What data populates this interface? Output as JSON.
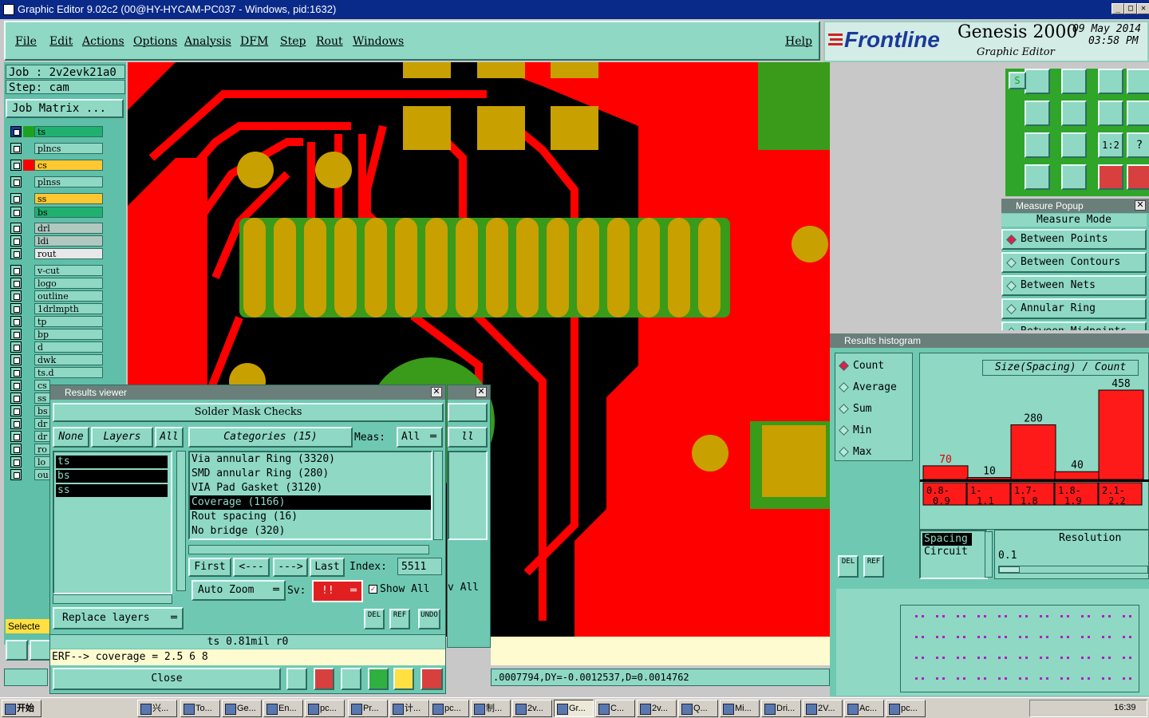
{
  "window": {
    "title": "Graphic Editor 9.02c2 (00@HY-HYCAM-PC037 - Windows, pid:1632)"
  },
  "menu": {
    "items": [
      "File",
      "Edit",
      "Actions",
      "Options",
      "Analysis",
      "DFM",
      "Step",
      "Rout",
      "Windows"
    ],
    "help": "Help"
  },
  "brand": {
    "logo": "Frontline",
    "product": "Genesis 2000",
    "subtitle": "Graphic Editor",
    "date": "09 May 2014",
    "time": "03:58 PM"
  },
  "job": {
    "job_label": "Job  : 2v2evk21a0",
    "step_label": "Step: cam",
    "matrix_button": "Job Matrix ..."
  },
  "layers": [
    {
      "name": "ts",
      "color": "#20a020",
      "active": true
    },
    {
      "name": "plncs",
      "color": ""
    },
    {
      "name": "cs",
      "color": "#ff0000",
      "active": true
    },
    {
      "name": "plnss",
      "color": ""
    },
    {
      "name": "ss",
      "color": "",
      "active": true
    },
    {
      "name": "bs",
      "color": ""
    },
    {
      "name": "drl",
      "color": ""
    },
    {
      "name": "ldi",
      "color": ""
    },
    {
      "name": "rout",
      "color": ""
    },
    {
      "name": "v-cut",
      "color": ""
    },
    {
      "name": "logo",
      "color": ""
    },
    {
      "name": "outline",
      "color": ""
    },
    {
      "name": "1drlmpth",
      "color": ""
    },
    {
      "name": "tp",
      "color": ""
    },
    {
      "name": "bp",
      "color": ""
    },
    {
      "name": "d",
      "color": ""
    },
    {
      "name": "dwk",
      "color": ""
    },
    {
      "name": "ts.d",
      "color": ""
    }
  ],
  "layers_lower": [
    "cs",
    "ss",
    "bs",
    "dr",
    "dr",
    "ro",
    "lo",
    "ou"
  ],
  "left_status": {
    "selected": "Selecte"
  },
  "results_viewer": {
    "title": "Results viewer",
    "header": "Solder Mask Checks",
    "none_btn": "None",
    "layers_btn": "Layers",
    "all_btn": "All",
    "categories_label": "Categories (15)",
    "meas_label": "Meas:",
    "meas_value": "All",
    "behind_all": "ll",
    "layers_list": [
      "ts",
      "bs",
      "ss"
    ],
    "categories": [
      "Via annular Ring (3320)",
      "SMD annular Ring (280)",
      "VIA Pad Gasket (3120)",
      "Coverage (1166)",
      "Rout spacing (16)",
      "No bridge (320)"
    ],
    "selected_category": 3,
    "nav": {
      "first": "First",
      "prev": "<---",
      "next": "--->",
      "last": "Last",
      "index_label": "Index:",
      "index_value": "5511"
    },
    "auto_zoom": "Auto Zoom",
    "sv_label": "Sv:",
    "sv_value": "!!",
    "show_all": "Show All",
    "behind_show_all": "v All",
    "replace_layers": "Replace layers",
    "icon_del": "DEL",
    "icon_ref": "REF",
    "icon_undo": "UNDO",
    "status1": "ts 0.81mil  r0",
    "status2": "ERF--> coverage = 2.5 6 8",
    "close": "Close"
  },
  "coords": {
    "text": ".0007794,DY=-0.0012537,D=0.0014762"
  },
  "measure_popup": {
    "title": "Measure Popup",
    "mode_label": "Measure Mode",
    "options": [
      "Between Points",
      "Between Contours",
      "Between Nets",
      "Annular Ring",
      "Between Midpoints"
    ],
    "selected": 0
  },
  "histogram": {
    "title": "Results histogram",
    "options": [
      "Count",
      "Average",
      "Sum",
      "Min",
      "Max"
    ],
    "selected": 0,
    "header": "Size(Spacing) / Count",
    "bars": [
      {
        "label": "0.8-0.9",
        "value": 70
      },
      {
        "label": "1-1.1",
        "value": 10
      },
      {
        "label": "1.7-1.8",
        "value": 280
      },
      {
        "label": "1.8-1.9",
        "value": 40
      },
      {
        "label": "2.1-2.2",
        "value": 458
      }
    ],
    "bar_color": "#ff1a1a",
    "list": [
      "Spacing",
      "Circuit"
    ],
    "resolution_label": "Resolution",
    "resolution_value": "0.1",
    "del": "DEL",
    "ref": "REF"
  },
  "taskbar": {
    "start": "开始",
    "items": [
      "兴...",
      "To...",
      "Ge...",
      "En...",
      "pc...",
      "Pr...",
      "计...",
      "pc...",
      "制...",
      "2v...",
      "Gr...",
      "C...",
      "2v...",
      "Q...",
      "Mi...",
      "Dri...",
      "2V...",
      "Ac...",
      "pc..."
    ],
    "clock": "16:39"
  },
  "colors": {
    "copper": "#ff0000",
    "mask": "#3a9a1a",
    "pad": "#c8a000",
    "bg": "#000000",
    "ui_teal": "#8ed8c4"
  }
}
